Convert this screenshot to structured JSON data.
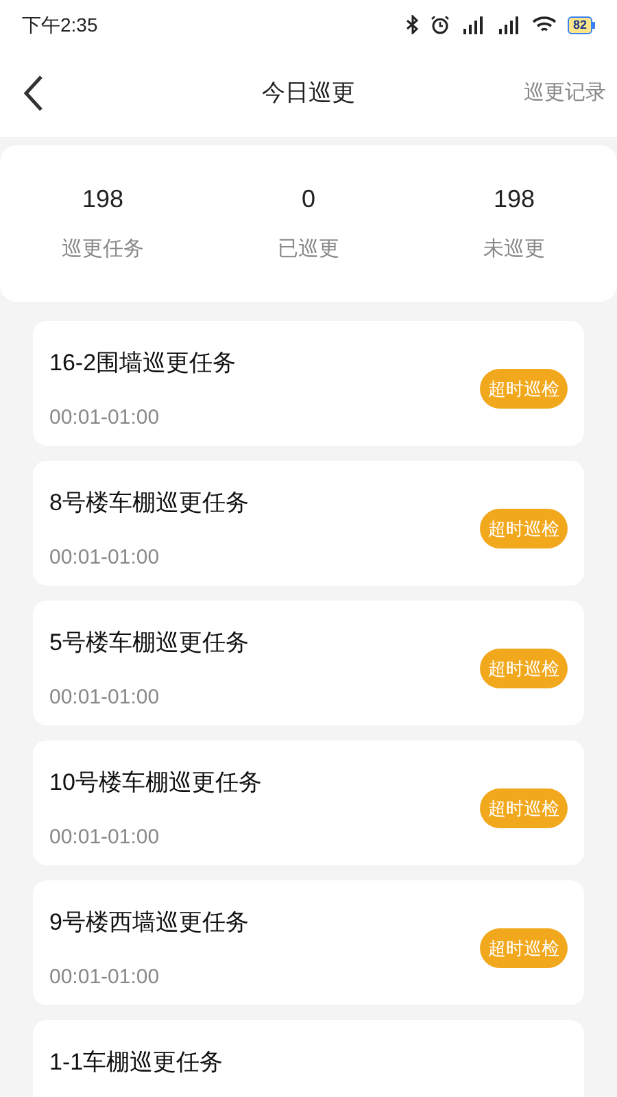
{
  "status_bar": {
    "time": "下午2:35",
    "battery": "82"
  },
  "header": {
    "title": "今日巡更",
    "action": "巡更记录"
  },
  "stats": [
    {
      "value": "198",
      "label": "巡更任务"
    },
    {
      "value": "0",
      "label": "已巡更"
    },
    {
      "value": "198",
      "label": "未巡更"
    }
  ],
  "tasks": [
    {
      "title": "16-2围墙巡更任务",
      "time": "00:01-01:00",
      "badge": "超时巡检"
    },
    {
      "title": "8号楼车棚巡更任务",
      "time": "00:01-01:00",
      "badge": "超时巡检"
    },
    {
      "title": "5号楼车棚巡更任务",
      "time": "00:01-01:00",
      "badge": "超时巡检"
    },
    {
      "title": "10号楼车棚巡更任务",
      "time": "00:01-01:00",
      "badge": "超时巡检"
    },
    {
      "title": "9号楼西墙巡更任务",
      "time": "00:01-01:00",
      "badge": "超时巡检"
    },
    {
      "title": "1-1车棚巡更任务"
    }
  ]
}
